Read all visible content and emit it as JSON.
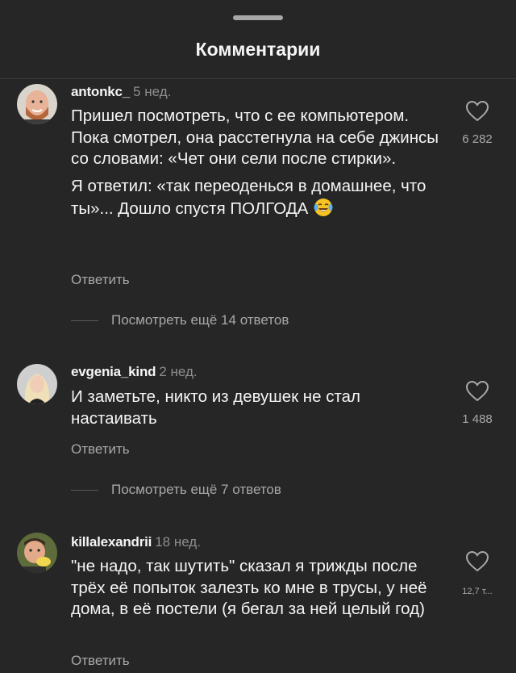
{
  "sheet": {
    "title": "Комментарии"
  },
  "comments": [
    {
      "username": "antonkc_",
      "time": "5 нед.",
      "paragraphs": [
        "Пришел посмотреть, что с ее компьютером. Пока смотрел, она расстегнула на себе джинсы со словами: «Чет они сели после стирки».",
        "Я ответил: «так переоденься в домашнее, что ты»... Дошло спустя ПОЛГОДА"
      ],
      "reply_label": "Ответить",
      "likes": "6 282",
      "more_replies": "Посмотреть ещё 14 ответов",
      "avatar_icon": "avatar-bald-man-beard"
    },
    {
      "username": "evgenia_kind",
      "time": "2 нед.",
      "paragraphs": [
        "И заметьте, никто из девушек не стал настаивать"
      ],
      "reply_label": "Ответить",
      "likes": "1 488",
      "more_replies": "Посмотреть ещё 7 ответов",
      "avatar_icon": "avatar-blonde-woman"
    },
    {
      "username": "killalexandrii",
      "time": "18 нед.",
      "paragraphs": [
        "\"не надо, так шутить\" сказал я трижды после трёх её попыток залезть ко мне в трусы, у неё дома, в её постели (я бегал за ней целый год)"
      ],
      "reply_label": "Ответить",
      "likes": "12,7 т...",
      "avatar_icon": "avatar-man-eating"
    }
  ],
  "emoji": "face-with-tears-of-joy",
  "colors": {
    "background": "#262626",
    "text_primary": "#f5f5f5",
    "text_secondary": "#a8a8a8",
    "handle": "#a8a8a8"
  }
}
